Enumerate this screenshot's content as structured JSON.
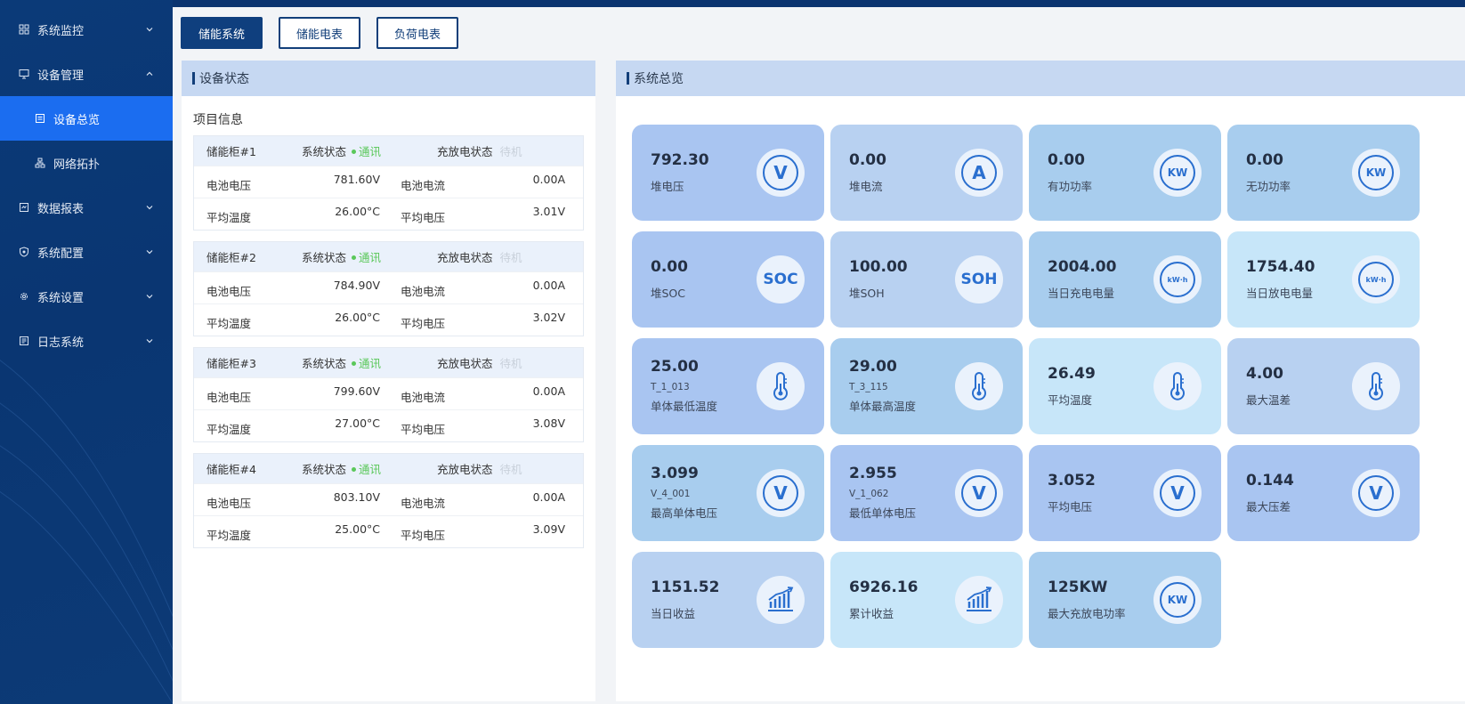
{
  "sidebar": {
    "items": [
      {
        "label": "系统监控",
        "icon": "grid-icon"
      },
      {
        "label": "设备管理",
        "icon": "monitor-icon"
      },
      {
        "label": "设备总览",
        "icon": "list-icon"
      },
      {
        "label": "网络拓扑",
        "icon": "topology-icon"
      },
      {
        "label": "数据报表",
        "icon": "report-icon"
      },
      {
        "label": "系统配置",
        "icon": "shield-icon"
      },
      {
        "label": "系统设置",
        "icon": "gear-icon"
      },
      {
        "label": "日志系统",
        "icon": "log-icon"
      }
    ]
  },
  "tabs": [
    {
      "label": "储能系统",
      "active": true
    },
    {
      "label": "储能电表",
      "active": false
    },
    {
      "label": "负荷电表",
      "active": false
    }
  ],
  "device_status": {
    "title": "设备状态",
    "project_label": "项目信息",
    "cabinets": [
      {
        "name": "储能柜#1",
        "sys_label": "系统状态",
        "sys_status": "通讯",
        "cd_label": "充放电状态",
        "cd_status": "待机",
        "batt_v_label": "电池电压",
        "batt_v": "781.60V",
        "batt_i_label": "电池电流",
        "batt_i": "0.00A",
        "avg_t_label": "平均温度",
        "avg_t": "26.00°C",
        "avg_v_label": "平均电压",
        "avg_v": "3.01V"
      },
      {
        "name": "储能柜#2",
        "sys_label": "系统状态",
        "sys_status": "通讯",
        "cd_label": "充放电状态",
        "cd_status": "待机",
        "batt_v_label": "电池电压",
        "batt_v": "784.90V",
        "batt_i_label": "电池电流",
        "batt_i": "0.00A",
        "avg_t_label": "平均温度",
        "avg_t": "26.00°C",
        "avg_v_label": "平均电压",
        "avg_v": "3.02V"
      },
      {
        "name": "储能柜#3",
        "sys_label": "系统状态",
        "sys_status": "通讯",
        "cd_label": "充放电状态",
        "cd_status": "待机",
        "batt_v_label": "电池电压",
        "batt_v": "799.60V",
        "batt_i_label": "电池电流",
        "batt_i": "0.00A",
        "avg_t_label": "平均温度",
        "avg_t": "27.00°C",
        "avg_v_label": "平均电压",
        "avg_v": "3.08V"
      },
      {
        "name": "储能柜#4",
        "sys_label": "系统状态",
        "sys_status": "通讯",
        "cd_label": "充放电状态",
        "cd_status": "待机",
        "batt_v_label": "电池电压",
        "batt_v": "803.10V",
        "batt_i_label": "电池电流",
        "batt_i": "0.00A",
        "avg_t_label": "平均温度",
        "avg_t": "25.00°C",
        "avg_v_label": "平均电压",
        "avg_v": "3.09V"
      }
    ]
  },
  "overview": {
    "title": "系统总览",
    "cards": [
      {
        "value": "792.30",
        "label": "堆电压",
        "icon": "voltage-icon",
        "sub": ""
      },
      {
        "value": "0.00",
        "label": "堆电流",
        "icon": "current-icon",
        "sub": ""
      },
      {
        "value": "0.00",
        "label": "有功功率",
        "icon": "kw-icon",
        "sub": ""
      },
      {
        "value": "0.00",
        "label": "无功功率",
        "icon": "kw-icon",
        "sub": ""
      },
      {
        "value": "0.00",
        "label": "堆SOC",
        "icon": "soc-icon",
        "sub": ""
      },
      {
        "value": "100.00",
        "label": "堆SOH",
        "icon": "soh-icon",
        "sub": ""
      },
      {
        "value": "2004.00",
        "label": "当日充电电量",
        "icon": "kwh-icon",
        "sub": ""
      },
      {
        "value": "1754.40",
        "label": "当日放电电量",
        "icon": "kwh-icon",
        "sub": ""
      },
      {
        "value": "25.00",
        "label": "单体最低温度",
        "icon": "thermometer-icon",
        "sub": "T_1_013"
      },
      {
        "value": "29.00",
        "label": "单体最高温度",
        "icon": "thermometer-icon",
        "sub": "T_3_115"
      },
      {
        "value": "26.49",
        "label": "平均温度",
        "icon": "thermometer-icon",
        "sub": ""
      },
      {
        "value": "4.00",
        "label": "最大温差",
        "icon": "thermometer-icon",
        "sub": ""
      },
      {
        "value": "3.099",
        "label": "最高单体电压",
        "icon": "voltage-icon",
        "sub": "V_4_001"
      },
      {
        "value": "2.955",
        "label": "最低单体电压",
        "icon": "voltage-icon",
        "sub": "V_1_062"
      },
      {
        "value": "3.052",
        "label": "平均电压",
        "icon": "voltage-icon",
        "sub": ""
      },
      {
        "value": "0.144",
        "label": "最大压差",
        "icon": "voltage-icon",
        "sub": ""
      },
      {
        "value": "1151.52",
        "label": "当日收益",
        "icon": "revenue-chart-icon",
        "sub": ""
      },
      {
        "value": "6926.16",
        "label": "累计收益",
        "icon": "revenue-chart-icon",
        "sub": ""
      },
      {
        "value": "125KW",
        "label": "最大充放电功率",
        "icon": "kw-icon",
        "sub": ""
      }
    ],
    "icon_text": {
      "voltage": "V",
      "current": "A",
      "kw": "KW",
      "kwh": "kW·h",
      "soc": "SOC",
      "soh": "SOH"
    }
  },
  "colors": {
    "sidebar": "#0a3672",
    "active_nav": "#1b6df0",
    "accent": "#2a6fcf",
    "ok": "#5ac85a"
  }
}
